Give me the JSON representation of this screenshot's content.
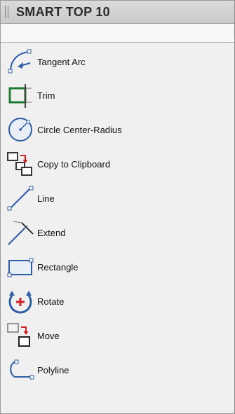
{
  "panel": {
    "title": "SMART TOP 10"
  },
  "items": [
    {
      "label": "Tangent Arc",
      "icon": "tangent-arc-icon"
    },
    {
      "label": "Trim",
      "icon": "trim-icon"
    },
    {
      "label": "Circle Center-Radius",
      "icon": "circle-center-radius-icon"
    },
    {
      "label": "Copy to Clipboard",
      "icon": "copy-to-clipboard-icon"
    },
    {
      "label": "Line",
      "icon": "line-icon"
    },
    {
      "label": "Extend",
      "icon": "extend-icon"
    },
    {
      "label": "Rectangle",
      "icon": "rectangle-icon"
    },
    {
      "label": "Rotate",
      "icon": "rotate-icon"
    },
    {
      "label": "Move",
      "icon": "move-icon"
    },
    {
      "label": "Polyline",
      "icon": "polyline-icon"
    }
  ],
  "colors": {
    "icon_blue": "#2f5da8",
    "trim_green": "#1e7a2e",
    "accent_red": "#d21f1f"
  }
}
